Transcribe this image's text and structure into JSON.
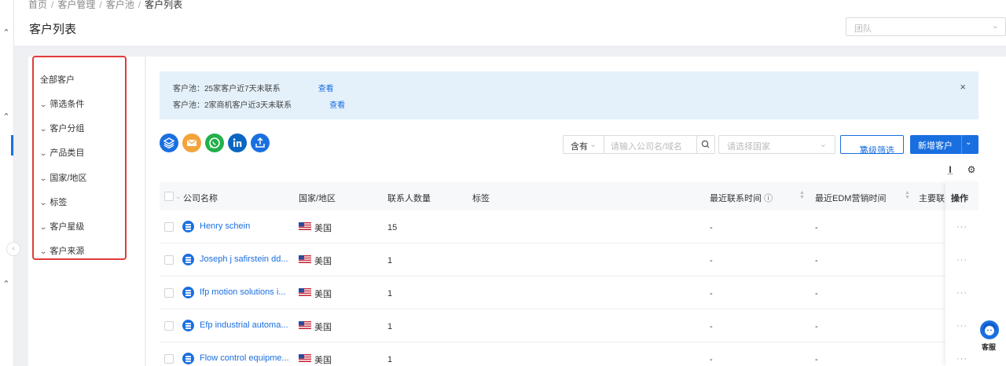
{
  "breadcrumb": [
    "首页",
    "客户管理",
    "客户池",
    "客户列表"
  ],
  "page_title": "客户列表",
  "team_select": {
    "placeholder": "团队"
  },
  "filters": {
    "all_label": "全部客户",
    "items": [
      "筛选条件",
      "客户分组",
      "产品类目",
      "国家/地区",
      "标签",
      "客户星级",
      "客户来源"
    ]
  },
  "notice": {
    "line1": "客户池：25家客户近7天未联系",
    "line2": "客户池：2家商机客户近3天未联系",
    "link_label": "查看",
    "close": "×"
  },
  "quick_icons": [
    {
      "name": "layers-icon",
      "color": "#1a6fe0"
    },
    {
      "name": "mail-icon",
      "color": "#f2a33a"
    },
    {
      "name": "whatsapp-icon",
      "color": "#22b04b"
    },
    {
      "name": "linkedin-icon",
      "color": "#0a66c2"
    },
    {
      "name": "upload-icon",
      "color": "#1a6fe0"
    }
  ],
  "search": {
    "match_mode": "含有",
    "placeholder": "请输入公司名/域名",
    "country_placeholder": "请选择国家",
    "advanced_label": "高级筛选",
    "new_label": "新增客户"
  },
  "table": {
    "headers": {
      "company": "公司名称",
      "country": "国家/地区",
      "contacts": "联系人数量",
      "tags": "标签",
      "last_contact": "最近联系时间",
      "last_edm": "最近EDM营销时间",
      "main_contact": "主要联系",
      "ops": "操作"
    },
    "rows": [
      {
        "company": "Henry schein",
        "country": "美国",
        "contacts": "15",
        "last_contact": "-",
        "last_edm": "-",
        "ops": "···"
      },
      {
        "company": "Joseph j safirstein dd...",
        "country": "美国",
        "contacts": "1",
        "last_contact": "-",
        "last_edm": "-",
        "ops": "···"
      },
      {
        "company": "Ifp motion solutions i...",
        "country": "美国",
        "contacts": "1",
        "last_contact": "-",
        "last_edm": "-",
        "ops": "···"
      },
      {
        "company": "Efp industrial automa...",
        "country": "美国",
        "contacts": "1",
        "last_contact": "-",
        "last_edm": "-",
        "ops": "···"
      },
      {
        "company": "Flow control equipme...",
        "country": "美国",
        "contacts": "1",
        "last_contact": "-",
        "last_edm": "-",
        "ops": "···"
      }
    ]
  },
  "customer_service_label": "客服"
}
